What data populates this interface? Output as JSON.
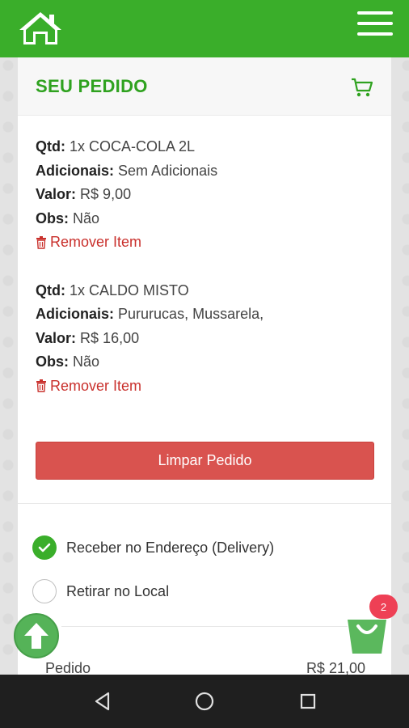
{
  "header": {
    "home_icon": "home-icon",
    "menu_icon": "hamburger-menu-icon",
    "brand_color": "#3aae2a"
  },
  "order": {
    "title": "SEU PEDIDO",
    "cart_icon": "cart-icon",
    "items": [
      {
        "qtd_label": "Qtd:",
        "qtd_value": "1x COCA-COLA 2L",
        "adicionais_label": "Adicionais:",
        "adicionais_value": "Sem Adicionais",
        "valor_label": "Valor:",
        "valor_value": "R$ 9,00",
        "obs_label": "Obs:",
        "obs_value": "Não",
        "remove_label": "Remover Item"
      },
      {
        "qtd_label": "Qtd:",
        "qtd_value": "1x CALDO MISTO",
        "adicionais_label": "Adicionais:",
        "adicionais_value": "Pururucas, Mussarela,",
        "valor_label": "Valor:",
        "valor_value": "R$ 16,00",
        "obs_label": "Obs:",
        "obs_value": "Não",
        "remove_label": "Remover Item"
      }
    ],
    "clear_button": "Limpar Pedido",
    "clear_color": "#d9534f",
    "remove_color": "#c9302c"
  },
  "delivery": {
    "options": [
      {
        "label": "Receber no Endereço (Delivery)",
        "checked": true
      },
      {
        "label": "Retirar no Local",
        "checked": false
      }
    ]
  },
  "totals": {
    "pedido_label": "Pedido",
    "pedido_value": "R$ 21,00"
  },
  "floating": {
    "scroll_top_icon": "arrow-up-icon",
    "bag_icon": "shopping-bag-icon",
    "bag_count": "2"
  },
  "system_nav": {
    "back_icon": "back-triangle-icon",
    "home_icon": "home-circle-icon",
    "recents_icon": "recents-square-icon"
  }
}
